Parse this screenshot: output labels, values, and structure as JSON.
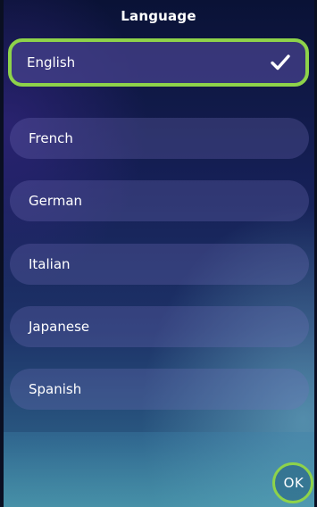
{
  "screen": {
    "title": "Language"
  },
  "languages": {
    "items": [
      {
        "label": "English",
        "selected": true
      },
      {
        "label": "French",
        "selected": false
      },
      {
        "label": "German",
        "selected": false
      },
      {
        "label": "Italian",
        "selected": false
      },
      {
        "label": "Japanese",
        "selected": false
      },
      {
        "label": "Spanish",
        "selected": false
      }
    ],
    "selected_icon": "checkmark-icon"
  },
  "footer": {
    "ok_label": "OK"
  },
  "colors": {
    "highlight": "#8ed34a",
    "text": "#ffffff"
  }
}
